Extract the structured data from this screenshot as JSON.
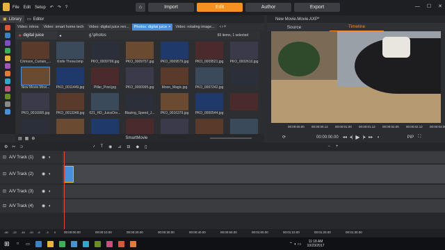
{
  "menu": {
    "items": [
      "File",
      "Edit",
      "Setup"
    ]
  },
  "nav": {
    "import": "Import",
    "edit": "Edit",
    "author": "Author",
    "export": "Export"
  },
  "library": {
    "title": "Library",
    "editor": "Editor",
    "tabs": [
      "Video: intros",
      "Video: smart home tech",
      "Video: digital juice ren...",
      "Photos: digital juice",
      "Video: rotating image..."
    ],
    "active_tab": 3,
    "folder": "digital juice",
    "path": "g:\\photos",
    "search_placeholder": "Search the current view",
    "count": "83 items, 1 selected",
    "tiles": [
      [
        "Crimson_Curtain_...",
        "Knife Throw.bmp",
        "PKO_0009799.jpg",
        "PKO_0009757.jpg",
        "PKO_0009579.jpg",
        "PKO_0009521.jpg",
        "PKO_0002610.jpg"
      ],
      [
        "New Movie.Movi...",
        "PKO_0011449.jpg",
        "Pillar_Post.jpg",
        "PKO_0000995.jpg",
        "Moon_Magic.jpg",
        "PKO_0007242.jpg",
        ""
      ],
      [
        "PKO_0016995.jpg",
        "PKO_0013348.jpg",
        "021_HD_JuiceDro...",
        "Blazing_Speed_J...",
        "PKO_0016379.jpg",
        "PKO_0000544.jpg",
        ""
      ],
      [
        "",
        "",
        "",
        "",
        "",
        "",
        ""
      ]
    ],
    "smartmovie": "SmartMovie"
  },
  "preview": {
    "title": "New Movie.Movie.AXP*",
    "tab_source": "Source",
    "tab_timeline": "Timeline",
    "ruler": [
      "00:00:00.00",
      "00:00:00.12",
      "00:00:01.00",
      "00:00:01.12",
      "00:00:02.00",
      "00:00:02.12",
      "00:00:03.00"
    ],
    "timecode": "00:00:00.00",
    "zoom": "PiP"
  },
  "timeline": {
    "tracks": [
      "A/V Track (1)",
      "A/V Track (2)",
      "A/V Track (3)",
      "A/V Track (4)"
    ],
    "ruler": [
      "00:00:00.00",
      "00:00:10.00",
      "00:00:20.00",
      "00:00:30.00",
      "00:00:40.00",
      "00:00:50.00",
      "00:01:00.00",
      "00:01:10.00",
      "00:01:20.00",
      "00:01:30.00"
    ],
    "meter": [
      "-60",
      "-22",
      "-16",
      "-10",
      "-6",
      "-3",
      "0"
    ]
  },
  "taskbar": {
    "time": "11:18 AM",
    "date": "10/23/2017"
  },
  "colors": {
    "accent": "#f39223",
    "tab_active": "#4a8fd9"
  }
}
